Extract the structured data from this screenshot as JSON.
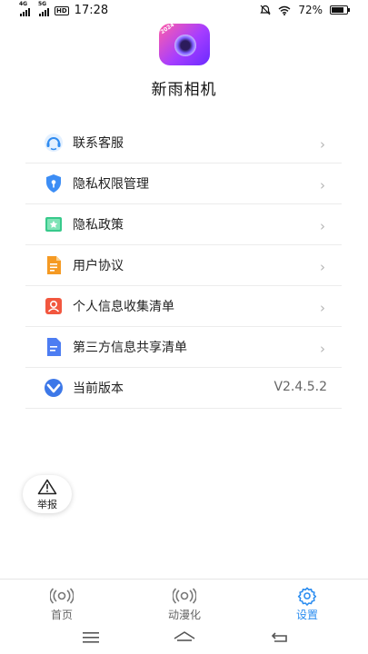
{
  "status_bar": {
    "network_1": "4G",
    "network_2": "5G",
    "hd_label": "HD",
    "time": "17:28",
    "battery_percent": "72%",
    "icons": [
      "signal-icon",
      "signal-icon",
      "alarm-off-icon",
      "wifi-icon",
      "battery-icon"
    ]
  },
  "app": {
    "name": "新雨相机",
    "icon_badge": "2024"
  },
  "menu": {
    "items": [
      {
        "label": "联系客服",
        "icon": "customer-service-icon",
        "color": "#2f8bf0"
      },
      {
        "label": "隐私权限管理",
        "icon": "shield-lock-icon",
        "color": "#3c8df5"
      },
      {
        "label": "隐私政策",
        "icon": "bookmark-star-icon",
        "color": "#37c98b"
      },
      {
        "label": "用户协议",
        "icon": "document-icon",
        "color": "#f59a23"
      },
      {
        "label": "个人信息收集清单",
        "icon": "person-card-icon",
        "color": "#f2573f"
      },
      {
        "label": "第三方信息共享清单",
        "icon": "document-list-icon",
        "color": "#4d7df2"
      },
      {
        "label": "当前版本",
        "icon": "app-logo-icon",
        "color": "#3d78e8"
      }
    ],
    "version_value": "V2.4.5.2"
  },
  "report_button": {
    "label": "举报",
    "icon": "warning-icon"
  },
  "tabs": [
    {
      "label": "首页",
      "icon": "broadcast-icon",
      "active": false
    },
    {
      "label": "动漫化",
      "icon": "broadcast-icon",
      "active": false
    },
    {
      "label": "设置",
      "icon": "gear-icon",
      "active": true
    }
  ],
  "colors": {
    "accent": "#2a8cf0",
    "divider": "#ececec"
  }
}
